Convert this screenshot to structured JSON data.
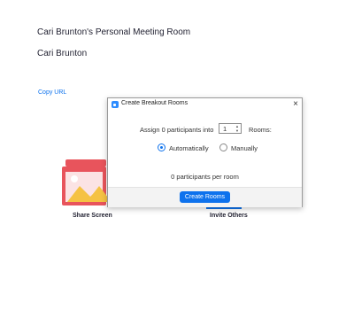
{
  "meeting": {
    "room_title": "Cari Brunton's Personal Meeting Room",
    "host_name": "Cari Brunton",
    "copy_url_label": "Copy URL"
  },
  "actions": {
    "share_screen_label": "Share Screen",
    "invite_others_label": "Invite Others"
  },
  "dialog": {
    "title": "Create Breakout Rooms",
    "assign_text": "Assign 0 participants into",
    "room_count": "1",
    "rooms_label": "Rooms:",
    "options": {
      "automatically": "Automatically",
      "manually": "Manually",
      "selected": "Automatically"
    },
    "per_room_text": "0 participants per room",
    "create_button": "Create Rooms",
    "close_glyph": "×"
  },
  "colors": {
    "accent": "#0e72ed",
    "share_red": "#e8545c",
    "share_yellow": "#f5c243"
  }
}
